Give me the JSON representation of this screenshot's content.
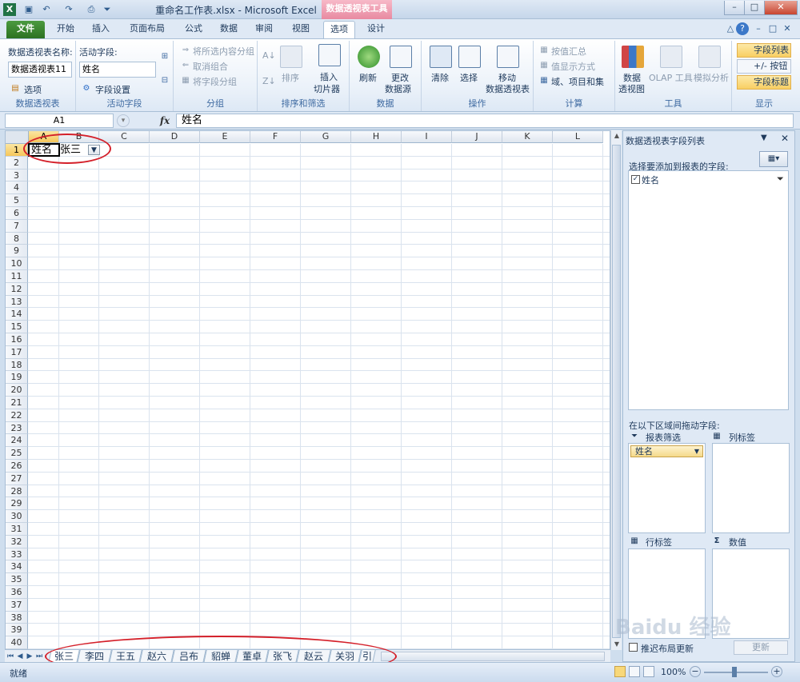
{
  "window": {
    "title": "重命名工作表.xlsx - Microsoft Excel",
    "context_tab_title": "数据透视表工具",
    "controls": {
      "minimize": "–",
      "restore": "□",
      "close": "✕"
    }
  },
  "tabs": [
    "文件",
    "开始",
    "插入",
    "页面布局",
    "公式",
    "数据",
    "审阅",
    "视图",
    "选项",
    "设计"
  ],
  "active_tab": "选项",
  "ribbon": {
    "pivot_group": {
      "name_label": "数据透视表名称:",
      "name_value": "数据透视表11",
      "options": "选项",
      "label": "数据透视表"
    },
    "field_group": {
      "field_label": "活动字段:",
      "field_value": "姓名",
      "field_settings": "字段设置",
      "label": "活动字段"
    },
    "group_group": {
      "group_selection": "将所选内容分组",
      "ungroup": "取消组合",
      "group_field": "将字段分组",
      "label": "分组"
    },
    "sort_group": {
      "sort": "排序",
      "slicer_1": "插入",
      "slicer_2": "切片器",
      "label": "排序和筛选"
    },
    "data_group": {
      "refresh": "刷新",
      "change_1": "更改",
      "change_2": "数据源",
      "label": "数据"
    },
    "action_group": {
      "clear": "清除",
      "select": "选择",
      "move_1": "移动",
      "move_2": "数据透视表",
      "label": "操作"
    },
    "calc_group": {
      "summarize": "按值汇总",
      "show_values": "值显示方式",
      "fields_items": "域、项目和集",
      "label": "计算"
    },
    "tools_group": {
      "pivotchart_1": "数据",
      "pivotchart_2": "透视图",
      "olap": "OLAP 工具",
      "whatif": "模拟分析",
      "label": "工具"
    },
    "show_group": {
      "field_list": "字段列表",
      "buttons": "+/- 按钮",
      "headers": "字段标题",
      "label": "显示"
    }
  },
  "formula_bar": {
    "name_box": "A1",
    "fx": "fx",
    "content": "姓名"
  },
  "grid": {
    "columns": [
      "A",
      "B",
      "C",
      "D",
      "E",
      "F",
      "G",
      "H",
      "I",
      "J",
      "K",
      "L"
    ],
    "rows": [
      "1",
      "2",
      "3",
      "4",
      "5",
      "6",
      "7",
      "8",
      "9",
      "10",
      "11",
      "12",
      "13",
      "14",
      "15",
      "16",
      "17",
      "18",
      "19",
      "20",
      "21",
      "22",
      "23",
      "24",
      "25",
      "26",
      "27",
      "28",
      "29",
      "30",
      "31",
      "32",
      "33",
      "34",
      "35",
      "36",
      "37",
      "38",
      "39",
      "40"
    ],
    "cells": {
      "A1": "姓名",
      "B1": "张三"
    }
  },
  "sheet_tabs": [
    "张三",
    "李四",
    "王五",
    "赵六",
    "吕布",
    "貂蝉",
    "董卓",
    "张飞",
    "赵云",
    "关羽",
    "引"
  ],
  "active_sheet": "张三",
  "status": {
    "ready": "就绪",
    "zoom": "100%"
  },
  "field_pane": {
    "title": "数据透视表字段列表",
    "choose_label": "选择要添加到报表的字段:",
    "fields": [
      {
        "name": "姓名",
        "checked": true
      }
    ],
    "drag_label": "在以下区域间拖动字段:",
    "report_filter": "报表筛选",
    "column_labels": "列标签",
    "row_labels": "行标签",
    "values": "数值",
    "filter_item": "姓名",
    "defer": "推迟布局更新",
    "update": "更新"
  },
  "watermark": "Baidu 经验",
  "colors": {
    "file_tab": "#2c7222",
    "context": "#e88aa1",
    "selection": "#f5c65b",
    "annotation": "#d4202a"
  }
}
